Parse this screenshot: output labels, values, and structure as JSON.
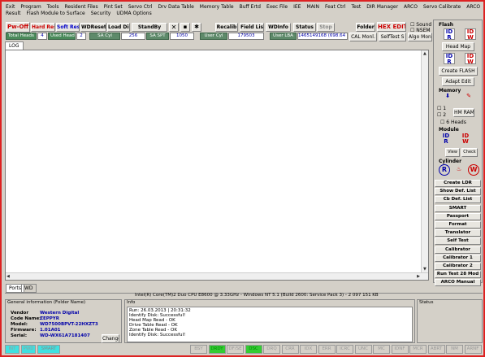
{
  "menu": [
    "Exit",
    "Program",
    "Tools",
    "Resident Files",
    "Pint Set",
    "Servo Ctrl",
    "Drv Data Table",
    "Memory Table",
    "Buff Ertd",
    "Exec File",
    "IEE",
    "MAIN",
    "Feat Ctrl",
    "Test",
    "DIR Manager",
    "ARCO",
    "Servo Calibrate",
    "ARCO Result",
    "Flash Module to Surface",
    "Security",
    "UDMA Options"
  ],
  "toolbar": {
    "pwr_off": "Pw-Off",
    "head_reset": "Hard Reset",
    "soft_reset": "Soft Reset",
    "wd_reset": "WDReset",
    "load_dir": "Load Dir",
    "standby": "StandBy",
    "recalib": "Recalib",
    "field_list": "Field List",
    "wd_info": "WDInfo",
    "status": "Status",
    "stop": "Stop",
    "folder": "Folder",
    "hex_edit": "HEX EDIT",
    "sound": "Sound",
    "nsem": "NSEM",
    "cal_monl": "CAL Monl.",
    "selftest": "SelfTest S",
    "algo_mon": "Algo Monl"
  },
  "status_row": {
    "total_heads_label": "Total Heads",
    "total_heads": "4",
    "used_heads_label": "Used Heads",
    "used_heads": "2",
    "sa_cyl_label": "SA Cyl",
    "sa_cyl": "256",
    "sa_spt_label": "SA SPT",
    "sa_spt": "1050",
    "user_cyl_label": "User Cyl",
    "user_cyl": "179503",
    "user_lba_label": "User LBA",
    "user_lba": "1465149168 (698.64 Gb)"
  },
  "log_tab": "LOG",
  "right_panel": {
    "flash_title": "Flash",
    "head_map": "Head Map",
    "create_flash": "Create FLASH",
    "adapt_edit": "Adapt Edit",
    "memory_title": "Memory",
    "hm_ram": "HM RAM",
    "mem_1": "1",
    "mem_2": "2",
    "heads_6": "6 Heads",
    "module_title": "Module",
    "view": "View",
    "check": "Check",
    "cylinder_title": "Cylinder",
    "buttons": [
      "Create LDR",
      "Show Def. List",
      "Cb Def. List",
      "SMART",
      "Passport",
      "Format",
      "Translator",
      "Self Test",
      "Calibrator",
      "Calibrator 1",
      "Calibrator 2",
      "Run Test 28 Mod",
      "ARCO Manual"
    ]
  },
  "bottom_tabs": [
    "Ports",
    "WD"
  ],
  "cpu_info": "Intel(R) Core(TM)2 Duo CPU    E8600  @ 3.33GHz - Windows NT 5.1 (Build 2600: Service Pack 3) - 2 097 151 KB",
  "general_info": {
    "title": "General information (Folder Name)",
    "rows": [
      {
        "k": "Vendor",
        "v": "Western Digital"
      },
      {
        "k": "Code Name:",
        "v": "ZEPPYR"
      },
      {
        "k": "Model:",
        "v": "WD7500BPVT-22HXZT3"
      },
      {
        "k": "Firmware:",
        "v": "1.01A01"
      },
      {
        "k": "Serial:",
        "v": "WD-WX61A7181407"
      }
    ],
    "change": "Change"
  },
  "info": {
    "title": "Info",
    "lines": [
      "Run: 26.03.2013 | 20:31:32",
      "Identify Disk: Successful!",
      "Head Map Read - OK",
      "Drive Table Read - OK",
      "Zone Table Read - OK",
      "Identify Disk: Successful!"
    ]
  },
  "status_box": {
    "title": "Status"
  },
  "status_bar": [
    "BSY",
    "DRDY",
    "DF/SE",
    "DSC",
    "DRQ",
    "CRR",
    "IDX",
    "ERR",
    "ICRC",
    "UNC",
    "MC",
    "IDNF",
    "MCR",
    "ABRT",
    "NM",
    "ARNF"
  ],
  "status_bar_left": [
    "INT",
    "PWD",
    "SMART"
  ],
  "colors": {
    "frame": "#dd2222",
    "led_green": "#33cc33",
    "led_cyan": "#40e0e0"
  }
}
